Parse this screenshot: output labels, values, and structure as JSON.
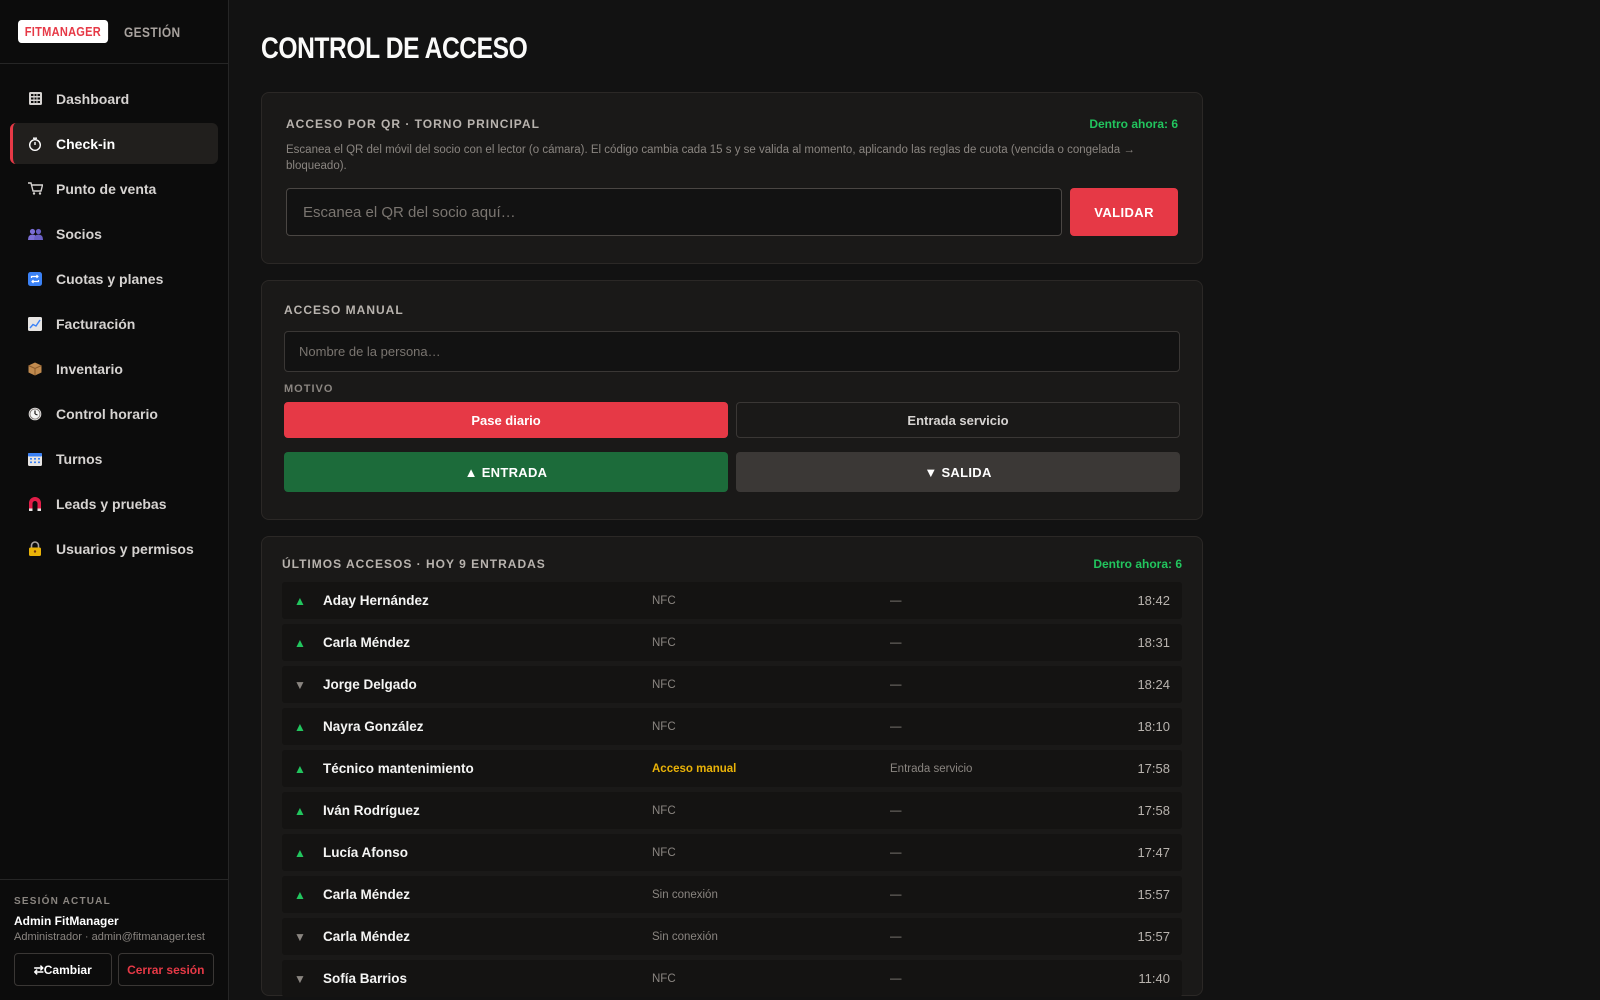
{
  "brand": {
    "logo": "FITMANAGER",
    "section": "GESTIÓN"
  },
  "sidebar": {
    "items": [
      {
        "label": "Dashboard",
        "icon": "grid-icon"
      },
      {
        "label": "Check-in",
        "icon": "stopwatch-icon",
        "active": true
      },
      {
        "label": "Punto de venta",
        "icon": "cart-icon"
      },
      {
        "label": "Socios",
        "icon": "people-icon"
      },
      {
        "label": "Cuotas y planes",
        "icon": "repeat-icon"
      },
      {
        "label": "Facturación",
        "icon": "chart-icon"
      },
      {
        "label": "Inventario",
        "icon": "box-icon"
      },
      {
        "label": "Control horario",
        "icon": "clock-icon"
      },
      {
        "label": "Turnos",
        "icon": "calendar-icon"
      },
      {
        "label": "Leads y pruebas",
        "icon": "magnet-icon"
      },
      {
        "label": "Usuarios y permisos",
        "icon": "lock-icon"
      }
    ]
  },
  "session": {
    "label": "SESIÓN ACTUAL",
    "name": "Admin FitManager",
    "detail": "Administrador · admin@fitmanager.test",
    "switch_label": "⇄Cambiar",
    "logout_label": "Cerrar sesión"
  },
  "page": {
    "title": "CONTROL DE ACCESO"
  },
  "qr": {
    "title": "ACCESO POR QR · TORNO PRINCIPAL",
    "inside": "Dentro ahora: 6",
    "description": "Escanea el QR del móvil del socio con el lector (o cámara). El código cambia cada 15 s y se valida al momento, aplicando las reglas de cuota (vencida o congelada → bloqueado).",
    "placeholder": "Escanea el QR del socio aquí…",
    "validate_label": "VALIDAR"
  },
  "manual": {
    "title": "ACCESO MANUAL",
    "placeholder": "Nombre de la persona…",
    "reason_label": "MOTIVO",
    "reasons": [
      "Pase diario",
      "Entrada servicio"
    ],
    "selected_reason": "Pase diario",
    "entry_label": "▲ ENTRADA",
    "exit_label": "▼ SALIDA"
  },
  "log": {
    "title": "ÚLTIMOS ACCESOS · HOY 9 ENTRADAS",
    "inside": "Dentro ahora: 6",
    "rows": [
      {
        "dir": "▲",
        "name": "Aday Hernández",
        "source": "NFC",
        "note": "—",
        "time": "18:42"
      },
      {
        "dir": "▲",
        "name": "Carla Méndez",
        "source": "NFC",
        "note": "—",
        "time": "18:31"
      },
      {
        "dir": "▼",
        "name": "Jorge Delgado",
        "source": "NFC",
        "note": "—",
        "time": "18:24"
      },
      {
        "dir": "▲",
        "name": "Nayra González",
        "source": "NFC",
        "note": "—",
        "time": "18:10"
      },
      {
        "dir": "▲",
        "name": "Técnico mantenimiento",
        "source": "Acceso manual",
        "note": "Entrada servicio",
        "time": "17:58"
      },
      {
        "dir": "▲",
        "name": "Iván Rodríguez",
        "source": "NFC",
        "note": "—",
        "time": "17:58"
      },
      {
        "dir": "▲",
        "name": "Lucía Afonso",
        "source": "NFC",
        "note": "—",
        "time": "17:47"
      },
      {
        "dir": "▲",
        "name": "Carla Méndez",
        "source": "Sin conexión",
        "note": "—",
        "time": "15:57"
      },
      {
        "dir": "▼",
        "name": "Carla Méndez",
        "source": "Sin conexión",
        "note": "—",
        "time": "15:57"
      },
      {
        "dir": "▼",
        "name": "Sofía Barrios",
        "source": "NFC",
        "note": "—",
        "time": "11:40"
      }
    ]
  },
  "colors": {
    "accent": "#e63946",
    "success": "#22c55e",
    "warning": "#eab308",
    "entry_button": "#1c6b3a"
  }
}
